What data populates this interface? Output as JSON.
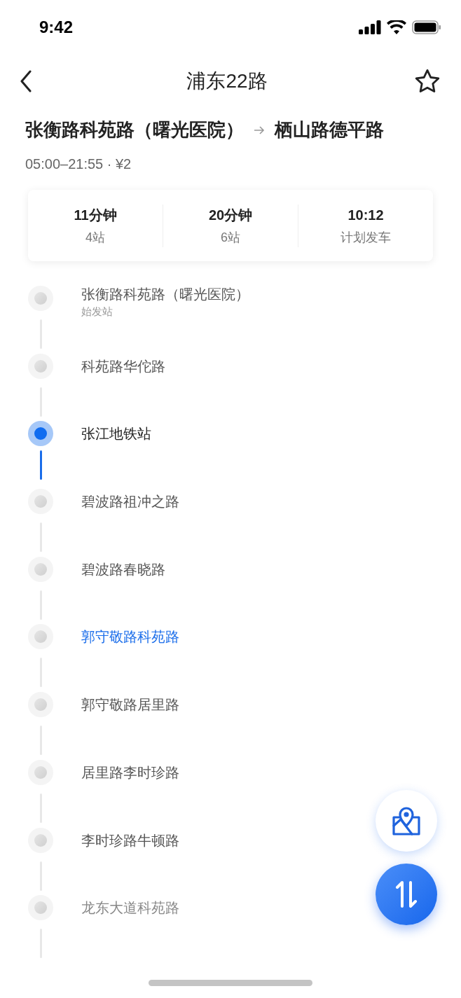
{
  "status_bar": {
    "time": "9:42"
  },
  "nav": {
    "title": "浦东22路",
    "favorite": false
  },
  "route": {
    "from": "张衡路科苑路（曙光医院）",
    "to": "栖山路德平路",
    "hours": "05:00–21:55 · ¥2"
  },
  "summary": [
    {
      "value": "11分钟",
      "label": "4站"
    },
    {
      "value": "20分钟",
      "label": "6站"
    },
    {
      "value": "10:12",
      "label": "计划发车"
    }
  ],
  "stops": [
    {
      "name": "张衡路科苑路（曙光医院）",
      "note": "始发站",
      "selected": false,
      "highlighted": false,
      "faded": false
    },
    {
      "name": "科苑路华佗路",
      "selected": false,
      "highlighted": false,
      "faded": false
    },
    {
      "name": "张江地铁站",
      "selected": true,
      "highlighted": false,
      "faded": false
    },
    {
      "name": "碧波路祖冲之路",
      "selected": false,
      "highlighted": false,
      "faded": false
    },
    {
      "name": "碧波路春晓路",
      "selected": false,
      "highlighted": false,
      "faded": false
    },
    {
      "name": "郭守敬路科苑路",
      "selected": false,
      "highlighted": true,
      "faded": false
    },
    {
      "name": "郭守敬路居里路",
      "selected": false,
      "highlighted": false,
      "faded": false
    },
    {
      "name": "居里路李时珍路",
      "selected": false,
      "highlighted": false,
      "faded": false
    },
    {
      "name": "李时珍路牛顿路",
      "selected": false,
      "highlighted": false,
      "faded": false
    },
    {
      "name": "龙东大道科苑路",
      "selected": false,
      "highlighted": false,
      "faded": true
    }
  ]
}
